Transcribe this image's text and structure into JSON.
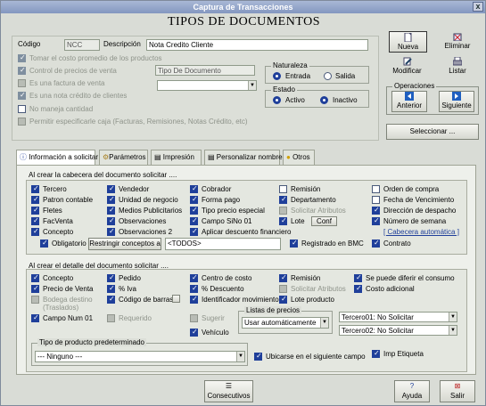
{
  "window": {
    "title": "Captura de Transacciones",
    "close": "x"
  },
  "heading": "TIPOS DE DOCUMENTOS",
  "form": {
    "codigo_label": "Código",
    "codigo_value": "NCC",
    "descripcion_label": "Descripción",
    "descripcion_value": "Nota Credito Cliente",
    "opts": [
      "Tomar el costo promedio de los productos",
      "Control de precios de venta",
      "Es una factura de venta",
      "Es una nota crédito de clientes",
      "No maneja cantidad",
      "Permitir especificarle caja  (Facturas, Remisiones, Notas Crédito, etc)"
    ],
    "tipo_documento": "Tipo De Documento",
    "naturaleza": {
      "label": "Naturaleza",
      "entrada": "Entrada",
      "salida": "Salida"
    },
    "estado": {
      "label": "Estado",
      "activo": "Activo",
      "inactivo": "Inactivo"
    }
  },
  "actions": {
    "nueva": "Nueva",
    "eliminar": "Eliminar",
    "modificar": "Modificar",
    "listar": "Listar",
    "operaciones": "Operaciones",
    "anterior": "Anterior",
    "siguiente": "Siguiente",
    "seleccionar": "Seleccionar ..."
  },
  "tabs": [
    "Información a solicitar",
    "Parámetros",
    "Impresión",
    "Personalizar nombres",
    "Otros"
  ],
  "cabecera": {
    "title": "Al crear la cabecera del documento solicitar ....",
    "col1": [
      "Tercero",
      "Patron contable",
      "Fletes",
      "FacVenta",
      "Concepto"
    ],
    "col2": [
      "Vendedor",
      "Unidad de negocio",
      "Medios Publicitarios",
      "Observaciones",
      "Observaciones 2"
    ],
    "col3": [
      "Cobrador",
      "Forma pago",
      "Tipo precio especial",
      "Campo SiNo 01",
      "Aplicar descuento financiero"
    ],
    "col4": [
      "Remisión",
      "Departamento",
      "Solicitar Atributos",
      "Lote"
    ],
    "conf": "Conf",
    "col5": [
      "Orden de compra",
      "Fecha de Vencimiento",
      "Dirección de despacho",
      "Número de semana",
      "[ Cabecera automática ]"
    ],
    "obligatorio": "Obligatorio",
    "restringir": "Restringir conceptos a",
    "todos": "<TODOS>",
    "registrado": "Registrado en BMC",
    "contrato": "Contrato"
  },
  "detalle": {
    "title": "Al crear  el detalle del documento solicitar ....",
    "col1": [
      "Concepto",
      "Precio de Venta",
      "Bodega destino (Traslados)",
      "Campo Num 01"
    ],
    "col2": [
      "Pedido",
      "% Iva",
      "Código de barras",
      "Requerido"
    ],
    "col3": [
      "Centro de costo",
      "% Descuento",
      "Identificador movimiento",
      "Sugerir",
      "Vehículo"
    ],
    "col4": [
      "Remisión",
      "Solicitar Atributos",
      "Lote producto"
    ],
    "col5": [
      "Se puede diferir el consumo",
      "Costo adicional"
    ],
    "listas": "Listas de precios",
    "listas_value": "Usar automáticamente",
    "tercero01": "Tercero01: No Solicitar",
    "tercero02": "Tercero02: No Solicitar",
    "tipo_producto": "Tipo de producto predeterminado",
    "tipo_value": "--- Ninguno ---",
    "ubicarse": "Ubicarse en el siguiente campo",
    "imp_etiqueta": "Imp Etiqueta"
  },
  "footer": {
    "consecutivos": "Consecutivos",
    "ayuda": "Ayuda",
    "salir": "Salir"
  },
  "colors": {
    "accent": "#1f3f9a",
    "title_bar": "#8397c0"
  }
}
